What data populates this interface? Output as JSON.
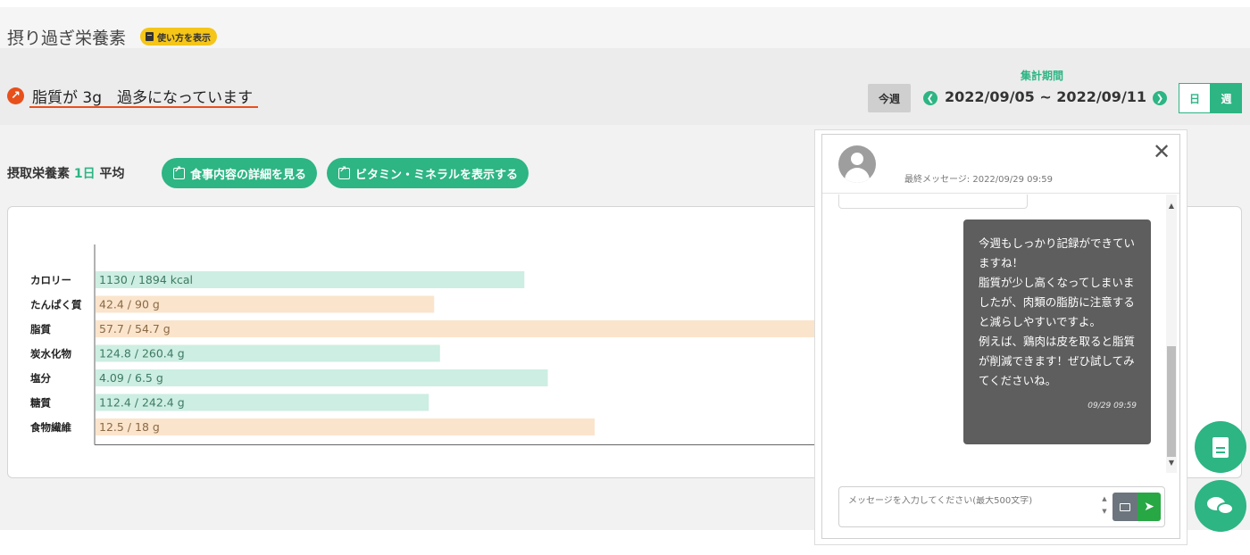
{
  "header": {
    "title": "摂り過ぎ栄養素",
    "howto_label": "使い方を表示"
  },
  "alert": {
    "icon": "arrow-up-right-icon",
    "text": "脂質が 3g　過多になっています",
    "color": "#e8501b"
  },
  "period": {
    "label": "集計期間",
    "this_week_label": "今週",
    "range": "2022/09/05 ~ 2022/09/11",
    "prev_icon": "arrow-left-icon",
    "next_icon": "arrow-right-icon",
    "toggle_day": "日",
    "toggle_week": "週"
  },
  "section": {
    "title_prefix": "摂取栄養素",
    "title_highlight": "1日",
    "title_suffix": "平均",
    "detail_button": "食事内容の詳細を見る",
    "vitamin_button": "ビタミン・ミネラルを表示する"
  },
  "chart_data": {
    "type": "bar",
    "orientation": "horizontal",
    "categories": [
      "カロリー",
      "たんぱく質",
      "脂質",
      "炭水化物",
      "塩分",
      "糖質",
      "食物繊維"
    ],
    "intake": [
      1130,
      42.4,
      57.7,
      124.8,
      4.09,
      112.4,
      12.5
    ],
    "target": [
      1894,
      90,
      54.7,
      260.4,
      6.5,
      242.4,
      18
    ],
    "labels": [
      "1130 / 1894 kcal",
      "42.4 / 90 g",
      "57.7 / 54.7 g",
      "124.8 / 260.4 g",
      "4.09 / 6.5 g",
      "112.4 / 242.4 g",
      "12.5 / 18 g"
    ],
    "bar_colors": [
      "#cdeee2",
      "#fbe4cc",
      "#fbe4cc",
      "#cdeee2",
      "#cdeee2",
      "#cdeee2",
      "#fbe4cc"
    ],
    "label_colors": [
      "#3d7a64",
      "#8a6a45",
      "#8a6a45",
      "#3d7a64",
      "#3d7a64",
      "#3d7a64",
      "#8a6a45"
    ],
    "max_ratio": 1.0,
    "grid": false,
    "title": "",
    "xlabel": "",
    "ylabel": ""
  },
  "chat": {
    "last_message": "最終メッセージ: 2022/09/29 09:59",
    "close_icon": "close-icon",
    "message_text": "今週もしっかり記録ができていますね！\n脂質が少し高くなってしまいましたが、肉類の脂肪に注意すると減らしやすいですよ。\n例えば、鶏肉は皮を取ると脂質が削減できます！ぜひ試してみてくださいね。",
    "message_time": "09/29 09:59",
    "input_placeholder": "メッセージを入力してください(最大500文字)",
    "send_icon": "send-icon",
    "image_icon": "image-icon"
  },
  "fabs": {
    "doc_icon": "document-icon",
    "chat_icon": "chat-bubbles-icon"
  },
  "colors": {
    "brand": "#2db584",
    "alert": "#e8501b",
    "badge": "#f5c518"
  }
}
